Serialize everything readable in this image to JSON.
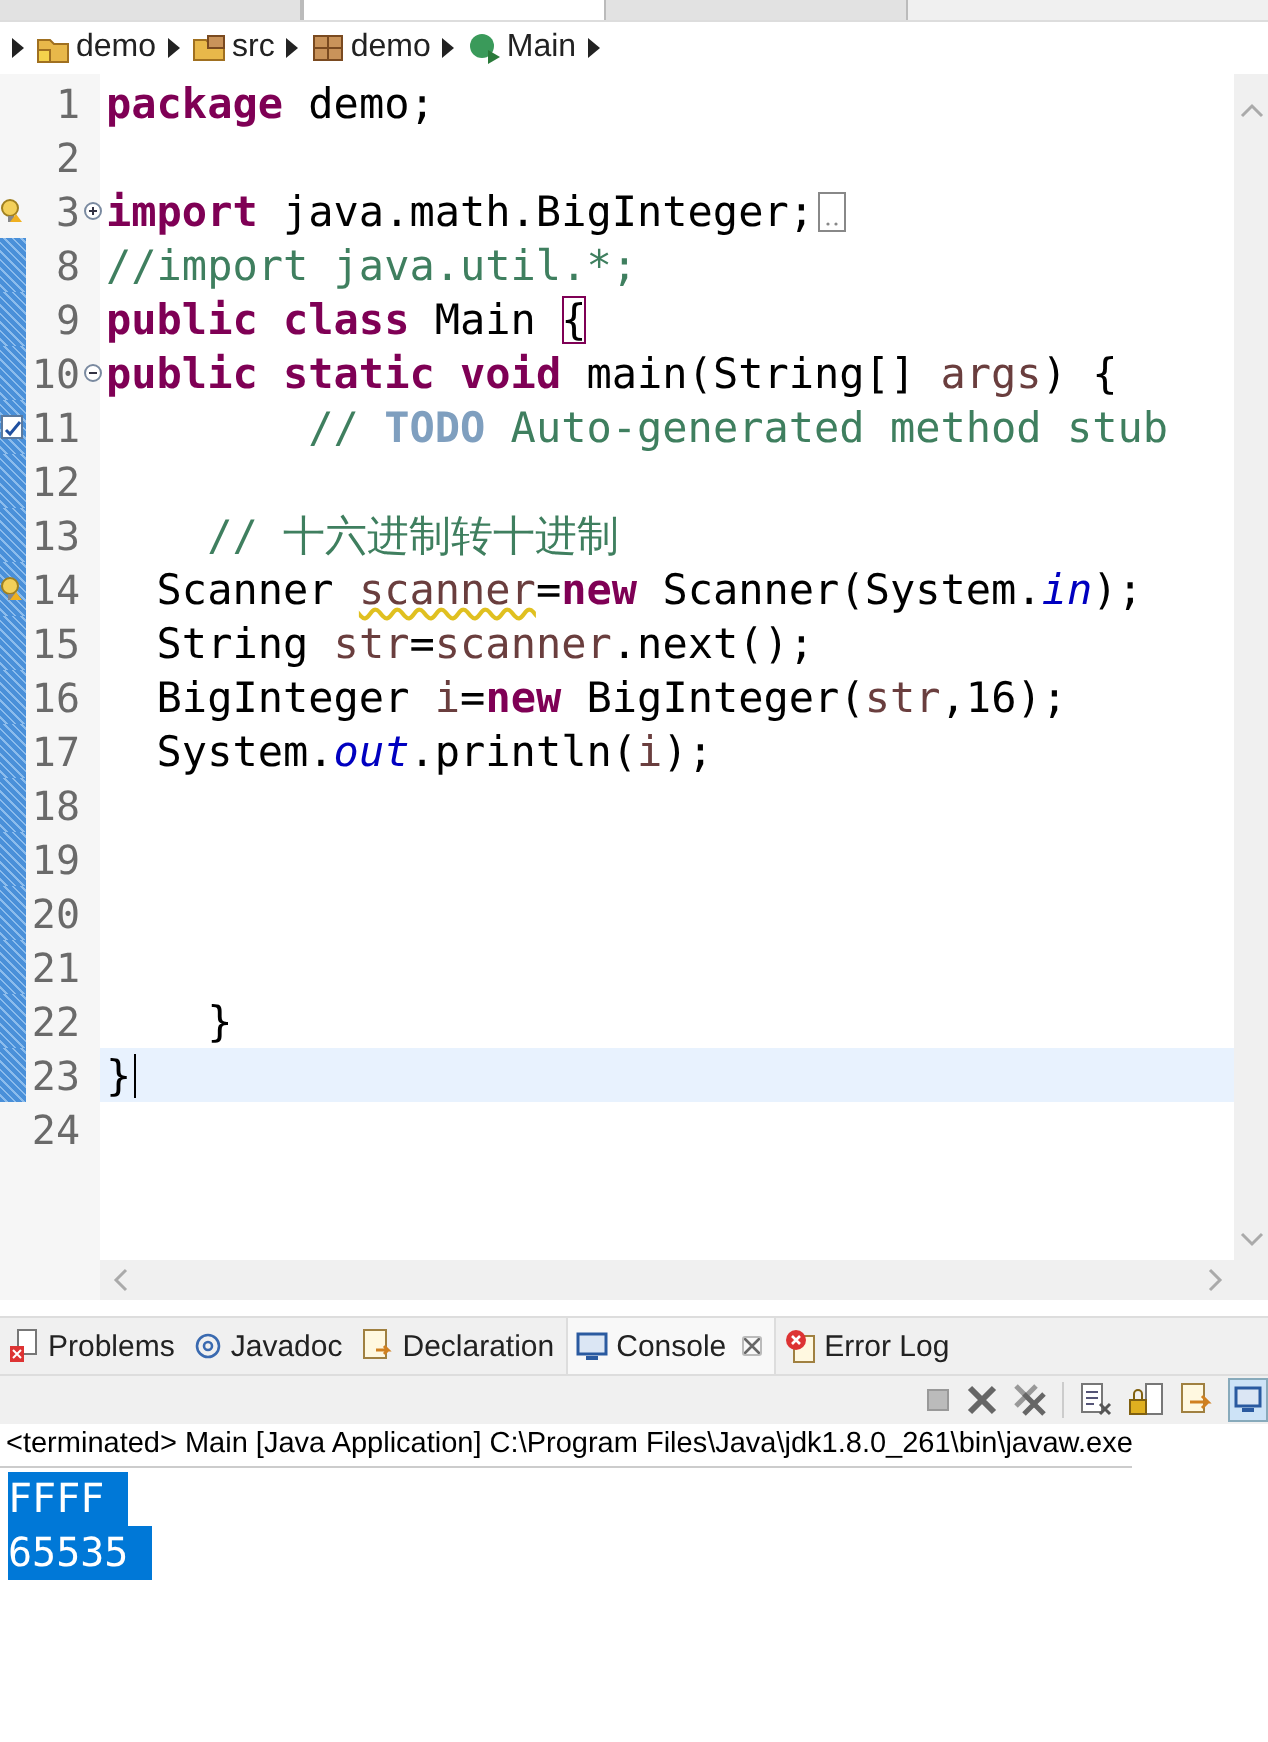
{
  "editor_tabs": [
    {
      "selected": false
    },
    {
      "selected": true
    },
    {
      "selected": false
    }
  ],
  "breadcrumb": [
    {
      "label": "demo",
      "kind": "project"
    },
    {
      "label": "src",
      "kind": "source"
    },
    {
      "label": "demo",
      "kind": "package"
    },
    {
      "label": "Main",
      "kind": "class"
    }
  ],
  "code_lines": [
    {
      "number": "1",
      "changed": false,
      "current": false,
      "tokens": [
        {
          "t": "package",
          "kind": "keyword"
        },
        {
          "t": " demo;",
          "kind": "plain"
        }
      ]
    },
    {
      "number": "2",
      "changed": false,
      "current": false
    },
    {
      "number": "3",
      "changed": false,
      "current": false,
      "fold": {
        "kind": "collapsed"
      },
      "annotation": {
        "kind": "warning"
      },
      "tokens": [
        {
          "t": "import",
          "kind": "keyword"
        },
        {
          "t": " java.math.BigInteger;",
          "kind": "plain"
        }
      ]
    },
    {
      "number": "8",
      "changed": true,
      "current": false,
      "tokens": [
        {
          "t": "//import java.util.*;",
          "kind": "comment"
        }
      ]
    },
    {
      "number": "9",
      "changed": true,
      "current": false,
      "tokens": [
        {
          "t": "public",
          "kind": "keyword"
        },
        {
          "t": " class",
          "kind": "keyword"
        },
        {
          "t": " Main ",
          "kind": "plain"
        },
        {
          "t": "{",
          "kind": "bracket"
        }
      ]
    },
    {
      "number": "10",
      "changed": true,
      "current": false,
      "fold": {
        "kind": "expanded"
      },
      "tokens": [
        {
          "t": "public",
          "kind": "keyword"
        },
        {
          "t": " static",
          "kind": "keyword"
        },
        {
          "t": " void",
          "kind": "keyword"
        },
        {
          "t": " main(String[] ",
          "kind": "plain"
        },
        {
          "t": "args",
          "kind": "variable"
        },
        {
          "t": ") {",
          "kind": "plain"
        }
      ]
    },
    {
      "number": "11",
      "changed": true,
      "current": false,
      "annotation": {
        "kind": "task"
      },
      "tokens": [
        {
          "t": "        // ",
          "kind": "comment"
        },
        {
          "t": "TODO",
          "kind": "task"
        },
        {
          "t": " Auto-generated method stub",
          "kind": "comment"
        }
      ]
    },
    {
      "number": "12",
      "changed": true,
      "current": false
    },
    {
      "number": "13",
      "changed": true,
      "current": false,
      "tokens": [
        {
          "t": "    // 十六进制转十进制",
          "kind": "comment"
        }
      ]
    },
    {
      "number": "14",
      "changed": true,
      "current": false,
      "annotation": {
        "kind": "warning"
      },
      "tokens": [
        {
          "t": "  Scanner ",
          "kind": "plain"
        },
        {
          "t": "scanner",
          "kind": "variable-warning"
        },
        {
          "t": "=",
          "kind": "plain"
        },
        {
          "t": "new",
          "kind": "keyword"
        },
        {
          "t": " Scanner(System.",
          "kind": "plain"
        },
        {
          "t": "in",
          "kind": "field"
        },
        {
          "t": ");",
          "kind": "plain"
        }
      ]
    },
    {
      "number": "15",
      "changed": true,
      "current": false,
      "tokens": [
        {
          "t": "  String ",
          "kind": "plain"
        },
        {
          "t": "str",
          "kind": "variable"
        },
        {
          "t": "=",
          "kind": "plain"
        },
        {
          "t": "scanner",
          "kind": "variable"
        },
        {
          "t": ".next();",
          "kind": "plain"
        }
      ]
    },
    {
      "number": "16",
      "changed": true,
      "current": false,
      "tokens": [
        {
          "t": "  BigInteger ",
          "kind": "plain"
        },
        {
          "t": "i",
          "kind": "variable"
        },
        {
          "t": "=",
          "kind": "plain"
        },
        {
          "t": "new",
          "kind": "keyword"
        },
        {
          "t": " BigInteger(",
          "kind": "plain"
        },
        {
          "t": "str",
          "kind": "variable"
        },
        {
          "t": ",16);",
          "kind": "plain"
        }
      ]
    },
    {
      "number": "17",
      "changed": true,
      "current": false,
      "tokens": [
        {
          "t": "  System.",
          "kind": "plain"
        },
        {
          "t": "out",
          "kind": "field"
        },
        {
          "t": ".println(",
          "kind": "plain"
        },
        {
          "t": "i",
          "kind": "variable"
        },
        {
          "t": ");",
          "kind": "plain"
        }
      ]
    },
    {
      "number": "18",
      "changed": true,
      "current": false
    },
    {
      "number": "19",
      "changed": true,
      "current": false
    },
    {
      "number": "20",
      "changed": true,
      "current": false
    },
    {
      "number": "21",
      "changed": true,
      "current": false
    },
    {
      "number": "22",
      "changed": true,
      "current": false,
      "tokens": [
        {
          "t": "    }",
          "kind": "plain"
        }
      ]
    },
    {
      "number": "23",
      "changed": true,
      "current": true,
      "tokens": [
        {
          "t": "}",
          "kind": "plain"
        }
      ]
    },
    {
      "number": "24",
      "changed": false,
      "current": false
    }
  ],
  "view_tabs": [
    {
      "label": "Problems",
      "kind": "problems",
      "selected": false
    },
    {
      "label": "Javadoc",
      "kind": "javadoc",
      "selected": false
    },
    {
      "label": "Declaration",
      "kind": "declaration",
      "selected": false
    },
    {
      "label": "Console",
      "kind": "console",
      "selected": true
    },
    {
      "label": "Error Log",
      "kind": "errorlog",
      "selected": false
    }
  ],
  "console": {
    "status": "<terminated> Main [Java Application] C:\\Program Files\\Java\\jdk1.8.0_261\\bin\\javaw.exe",
    "output": [
      {
        "text": "FFFF ",
        "selected": true
      },
      {
        "text": "65535 ",
        "selected": true
      }
    ]
  }
}
